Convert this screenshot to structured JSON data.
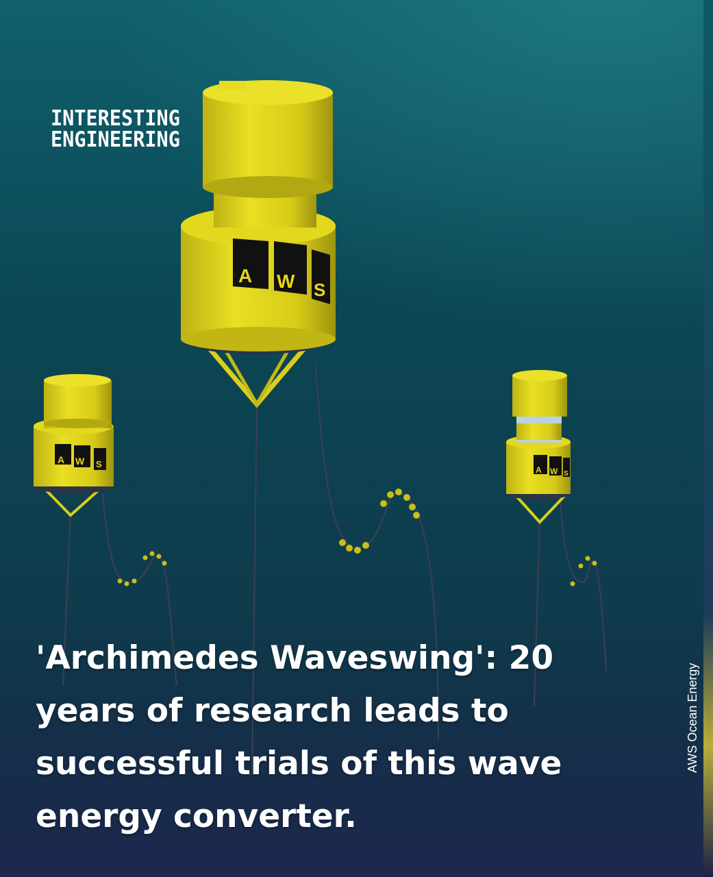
{
  "brand": {
    "logo_line1": "INTERESTING",
    "logo_line2": "ENGINEERING"
  },
  "headline": {
    "line1": "'Archimedes Waveswing': 20",
    "line2": "years of research leads to",
    "line3": "successful trials of this wave",
    "line4": "energy converter."
  },
  "credit": "AWS Ocean Energy",
  "buoy_label": {
    "letters": [
      "A",
      "W",
      "S"
    ]
  },
  "colors": {
    "water_top": "#0f5a66",
    "water_bottom": "#0d1a3a",
    "buoy_yellow": "#e2d71a",
    "underline_blue": "#1e7fd0"
  }
}
